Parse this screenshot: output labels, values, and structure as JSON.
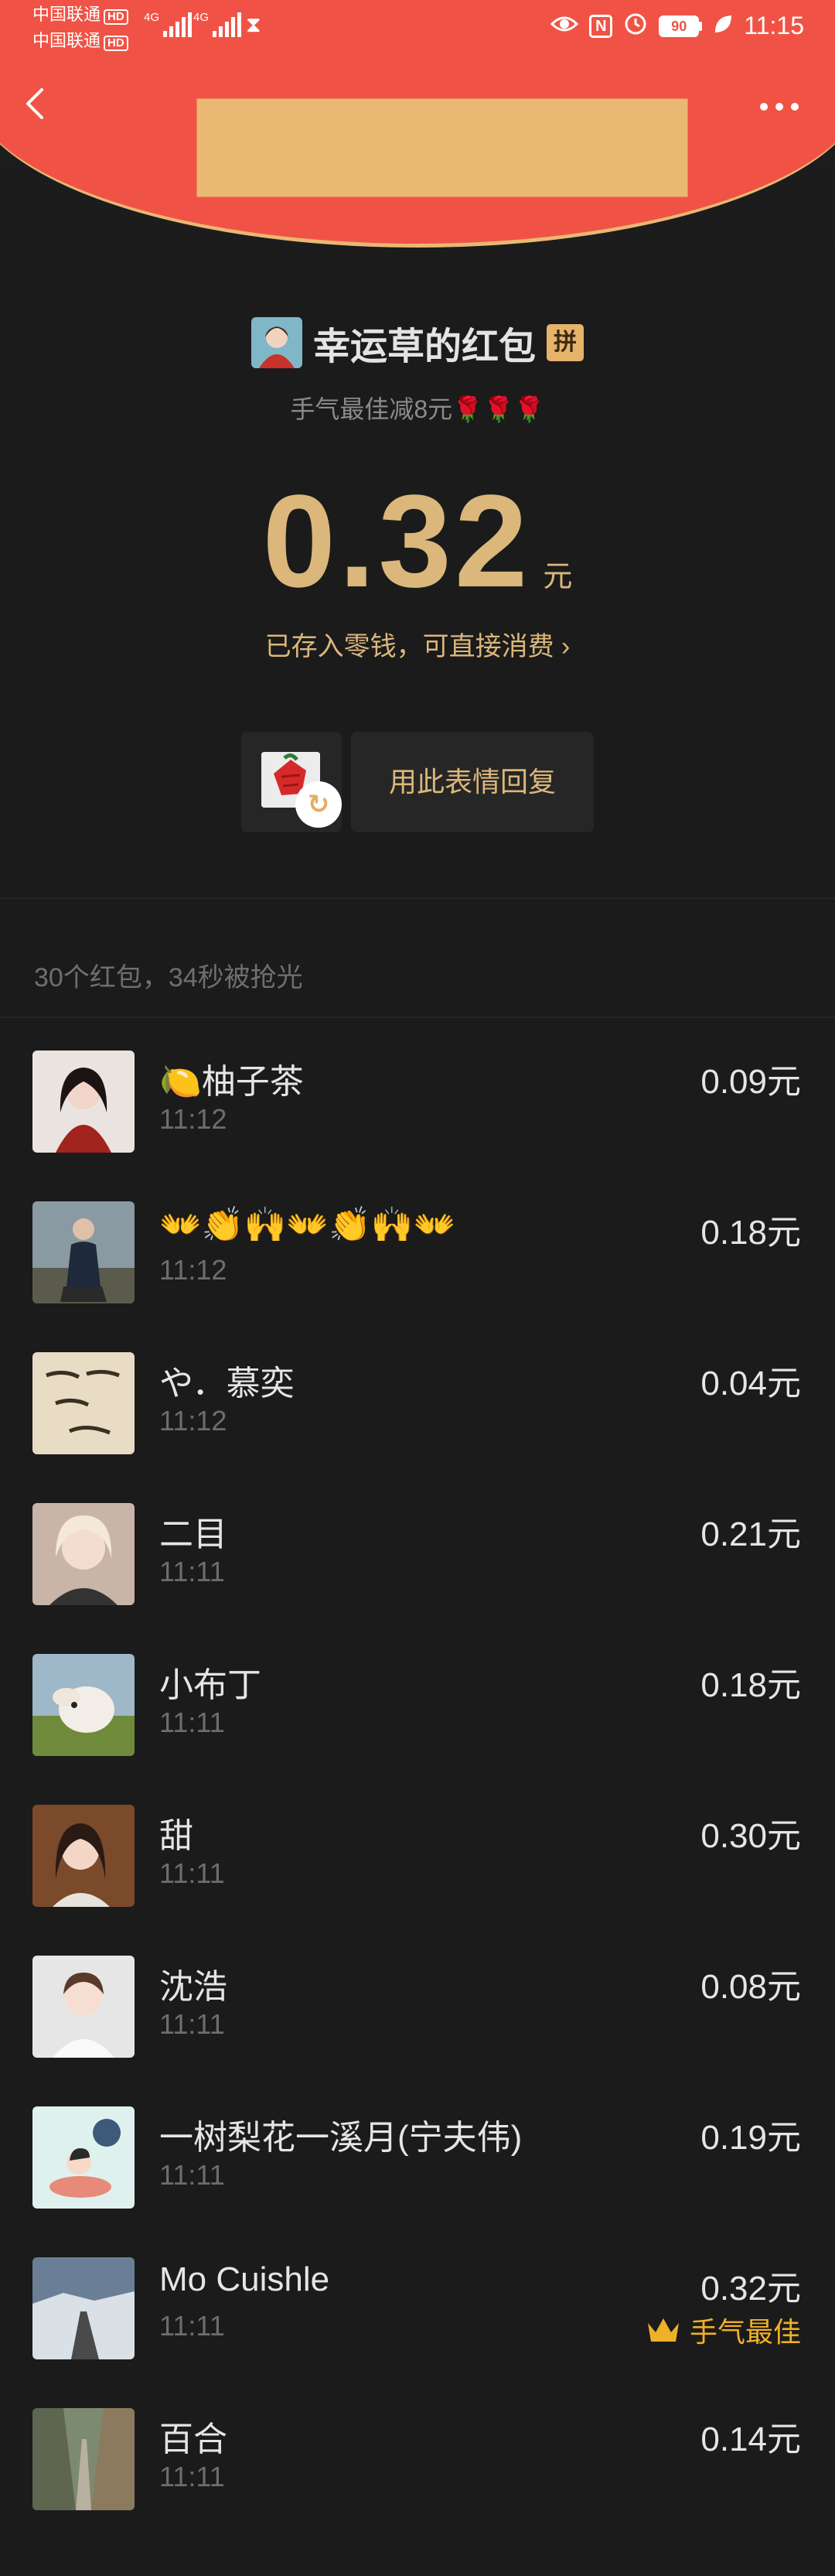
{
  "status_bar": {
    "carrier1": "中国联通",
    "carrier2": "中国联通",
    "hd1": "HD",
    "hd2": "HD",
    "net1": "4G",
    "net2": "4G",
    "battery": "90",
    "time": "11:15"
  },
  "header": {
    "sender_name": "幸运草的红包",
    "badge": "拼",
    "blessing": "手气最佳减8元🌹🌹🌹",
    "amount": "0.32",
    "unit": "元",
    "stored_note": "已存入零钱，可直接消费 ›",
    "reply_label": "用此表情回复"
  },
  "summary": "30个红包，34秒被抢光",
  "receivers": [
    {
      "name": "🍋柚子茶",
      "time": "11:12",
      "amount": "0.09元"
    },
    {
      "name": "👐👏🙌👐👏🙌👐",
      "time": "11:12",
      "amount": "0.18元"
    },
    {
      "name": "や．慕奕",
      "time": "11:12",
      "amount": "0.04元"
    },
    {
      "name": "二目",
      "time": "11:11",
      "amount": "0.21元"
    },
    {
      "name": "小布丁",
      "time": "11:11",
      "amount": "0.18元"
    },
    {
      "name": "甜",
      "time": "11:11",
      "amount": "0.30元"
    },
    {
      "name": "沈浩",
      "time": "11:11",
      "amount": "0.08元"
    },
    {
      "name": "一树梨花一溪月(宁夫伟)",
      "time": "11:11",
      "amount": "0.19元"
    },
    {
      "name": "Mo Cuishle",
      "time": "11:11",
      "amount": "0.32元",
      "best": "手气最佳"
    },
    {
      "name": "百合",
      "time": "11:11",
      "amount": "0.14元"
    }
  ],
  "colors": {
    "header_red": "#f05345",
    "gold": "#dbb77b",
    "best_orange": "#f0b028",
    "background": "#1b1b1b"
  }
}
